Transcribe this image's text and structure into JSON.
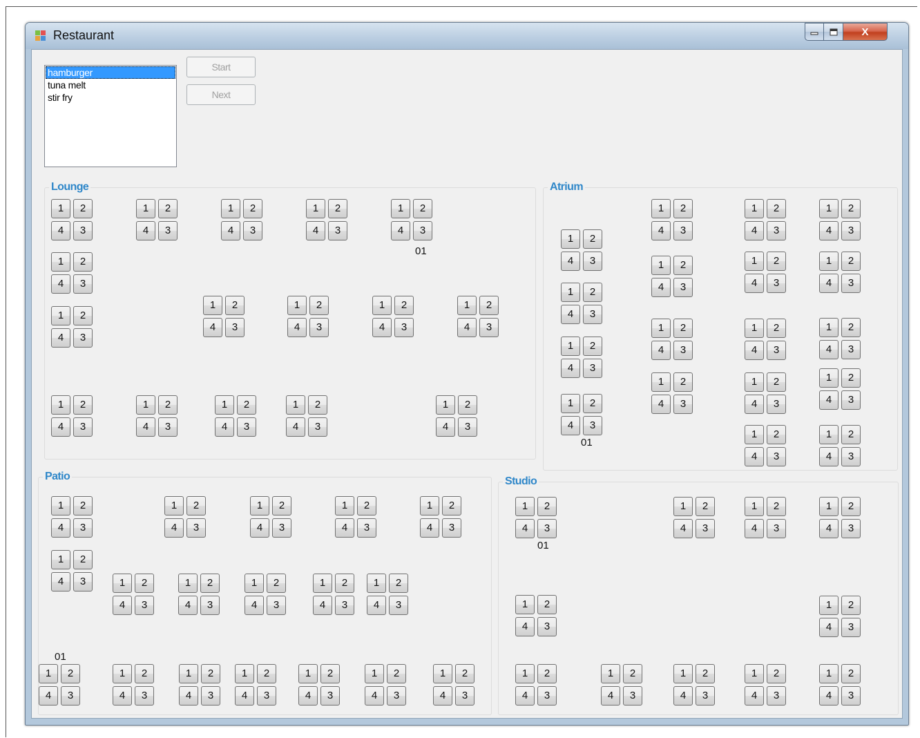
{
  "window": {
    "title": "Restaurant",
    "close_glyph": "X"
  },
  "menu": {
    "items": [
      "hamburger",
      "tuna melt",
      "stir fry"
    ],
    "selected_index": 0
  },
  "buttons": {
    "start": "Start",
    "next": "Next"
  },
  "seat_labels": {
    "top_left": "1",
    "top_right": "2",
    "bottom_left": "4",
    "bottom_right": "3"
  },
  "table_label": "01",
  "groups": {
    "lounge": {
      "label": "Lounge"
    },
    "atrium": {
      "label": "Atrium"
    },
    "patio": {
      "label": "Patio"
    },
    "studio": {
      "label": "Studio"
    }
  },
  "table_counts": {
    "lounge": 17,
    "atrium": 18,
    "patio": 18,
    "studio": 11
  },
  "colors": {
    "group_label": "#2f87c9",
    "selection": "#3399ff",
    "client_bg": "#f0f0f0"
  },
  "icons": [
    "app-icon",
    "minimize-icon",
    "maximize-icon",
    "close-icon"
  ]
}
